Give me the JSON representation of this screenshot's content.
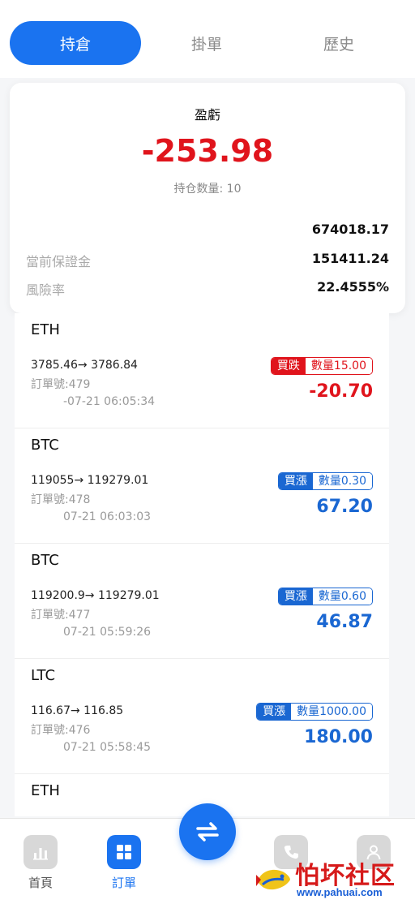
{
  "tabs": [
    {
      "label": "持倉",
      "active": true
    },
    {
      "label": "掛單",
      "active": false
    },
    {
      "label": "歷史",
      "active": false
    }
  ],
  "summary": {
    "pnl_label": "盈虧",
    "pnl_value": "-253.98",
    "position_count_label": "持仓数量:",
    "position_count": "10",
    "rows": [
      {
        "label": "",
        "value": "674018.17"
      },
      {
        "label": "當前保證金",
        "value": "151411.24"
      },
      {
        "label": "風險率",
        "value": "22.4555%"
      }
    ]
  },
  "orders": [
    {
      "symbol": "ETH",
      "prices": "3785.46→ 3786.84",
      "order_no": "訂單號:479",
      "time": "-07-21 06:05:34",
      "direction": "買跌",
      "quantity": "數量15.00",
      "profit": "-20.70",
      "trend": "down"
    },
    {
      "symbol": "BTC",
      "prices": "119055→ 119279.01",
      "order_no": "訂單號:478",
      "time": "07-21 06:03:03",
      "direction": "買漲",
      "quantity": "數量0.30",
      "profit": "67.20",
      "trend": "up"
    },
    {
      "symbol": "BTC",
      "prices": "119200.9→ 119279.01",
      "order_no": "訂單號:477",
      "time": "07-21 05:59:26",
      "direction": "買漲",
      "quantity": "數量0.60",
      "profit": "46.87",
      "trend": "up"
    },
    {
      "symbol": "LTC",
      "prices": "116.67→ 116.85",
      "order_no": "訂單號:476",
      "time": "07-21 05:58:45",
      "direction": "買漲",
      "quantity": "數量1000.00",
      "profit": "180.00",
      "trend": "up"
    },
    {
      "symbol": "ETH",
      "prices": "",
      "order_no": "",
      "time": "",
      "direction": "",
      "quantity": "",
      "profit": "",
      "trend": "up"
    }
  ],
  "bottom_nav": {
    "home": "首頁",
    "orders": "訂單",
    "item4": "",
    "item5": ""
  },
  "icons": {
    "home": "bar-chart-icon",
    "orders": "grid-icon",
    "center": "swap-arrows-icon",
    "item4": "phone-icon",
    "item5": "user-icon"
  },
  "colors": {
    "accent": "#1a73f0",
    "loss": "#e0141c",
    "gain": "#1a67d2"
  },
  "watermark": {
    "text": "怕坏社区",
    "url": "www.pahuai.com"
  }
}
